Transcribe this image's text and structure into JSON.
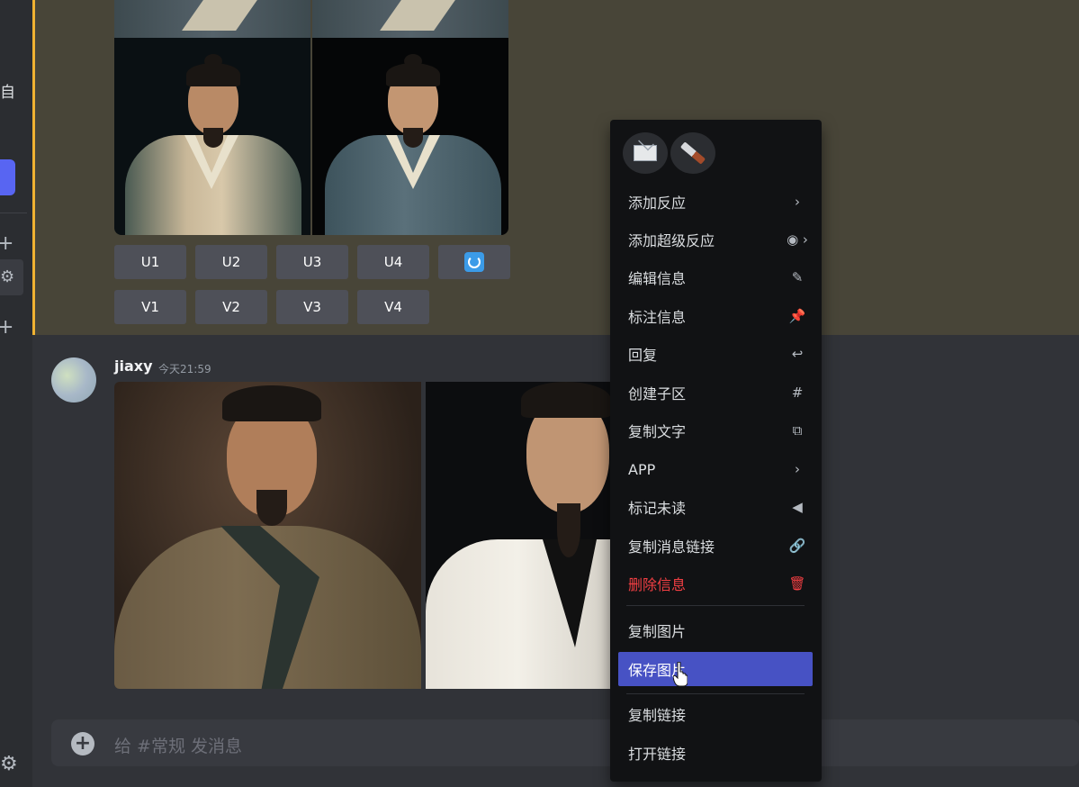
{
  "sidebar": {
    "server_letter": "自",
    "plus_glyph": "+",
    "gear_glyph": "⚙"
  },
  "upscale_buttons": [
    "U1",
    "U2",
    "U3",
    "U4"
  ],
  "variation_buttons": [
    "V1",
    "V2",
    "V3",
    "V4"
  ],
  "message": {
    "username": "jiaxy",
    "timestamp": "今天21:59"
  },
  "chat_input": {
    "placeholder": "给 #常规 发消息"
  },
  "context_menu": {
    "items": [
      {
        "label": "添加反应",
        "icon": "chevron-right-icon",
        "glyph": "›"
      },
      {
        "label": "添加超级反应",
        "icon": "super-reaction-icon",
        "glyph": "◉ ›"
      },
      {
        "label": "编辑信息",
        "icon": "pencil-icon",
        "glyph": "✎"
      },
      {
        "label": "标注信息",
        "icon": "pin-icon",
        "glyph": "📌"
      },
      {
        "label": "回复",
        "icon": "reply-icon",
        "glyph": "↩"
      },
      {
        "label": "创建子区",
        "icon": "thread-icon",
        "glyph": "#"
      },
      {
        "label": "复制文字",
        "icon": "copy-icon",
        "glyph": "⧉"
      },
      {
        "label": "APP",
        "icon": "chevron-right-icon",
        "glyph": "›"
      },
      {
        "label": "标记未读",
        "icon": "unread-icon",
        "glyph": "◀"
      },
      {
        "label": "复制消息链接",
        "icon": "link-icon",
        "glyph": "🔗"
      },
      {
        "label": "删除信息",
        "icon": "trash-icon",
        "glyph": "🗑",
        "danger": true
      },
      {
        "label": "复制图片",
        "icon": "",
        "glyph": ""
      },
      {
        "label": "保存图片",
        "icon": "",
        "glyph": "",
        "active": true
      },
      {
        "label": "复制链接",
        "icon": "",
        "glyph": ""
      },
      {
        "label": "打开链接",
        "icon": "",
        "glyph": ""
      }
    ]
  },
  "colors": {
    "accent": "#4752c4",
    "danger": "#f23f43",
    "mention_bar": "#f0b232",
    "mention_bg": "#484538"
  }
}
